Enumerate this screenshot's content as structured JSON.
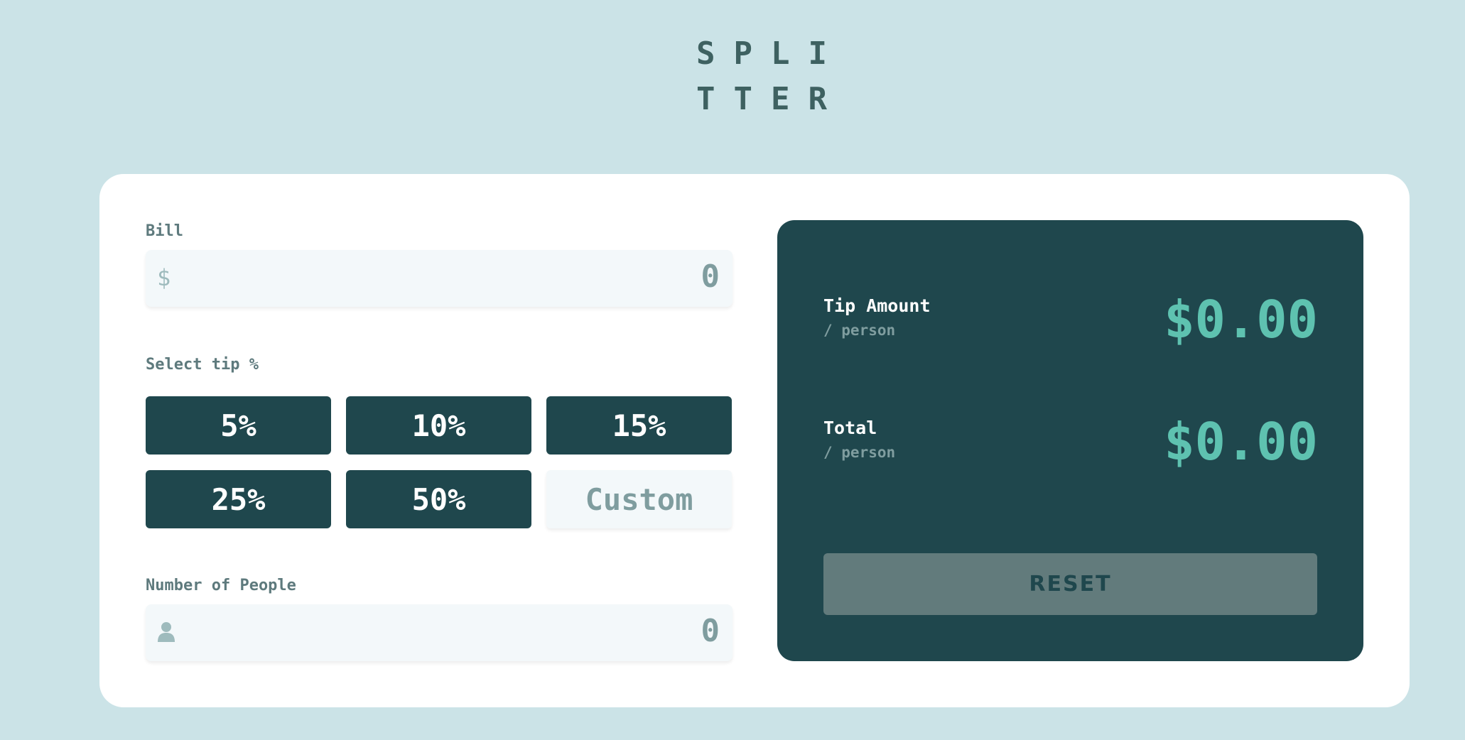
{
  "app": {
    "logo_line1": "SPLI",
    "logo_line2": "TTER"
  },
  "bill": {
    "label": "Bill",
    "prefix": "$",
    "value": "0"
  },
  "tip": {
    "label": "Select tip %",
    "options": [
      "5%",
      "10%",
      "15%",
      "25%",
      "50%"
    ],
    "custom_placeholder": "Custom"
  },
  "people": {
    "label": "Number of People",
    "icon": "person-icon",
    "value": "0"
  },
  "results": {
    "tip_label": "Tip Amount",
    "tip_sub": "/ person",
    "tip_value": "$0.00",
    "total_label": "Total",
    "total_sub": "/ person",
    "total_value": "$0.00",
    "reset_label": "RESET"
  },
  "colors": {
    "background": "#cbe3e7",
    "dark_teal": "#1f474d",
    "accent": "#5ec2b0",
    "card": "#ffffff"
  }
}
